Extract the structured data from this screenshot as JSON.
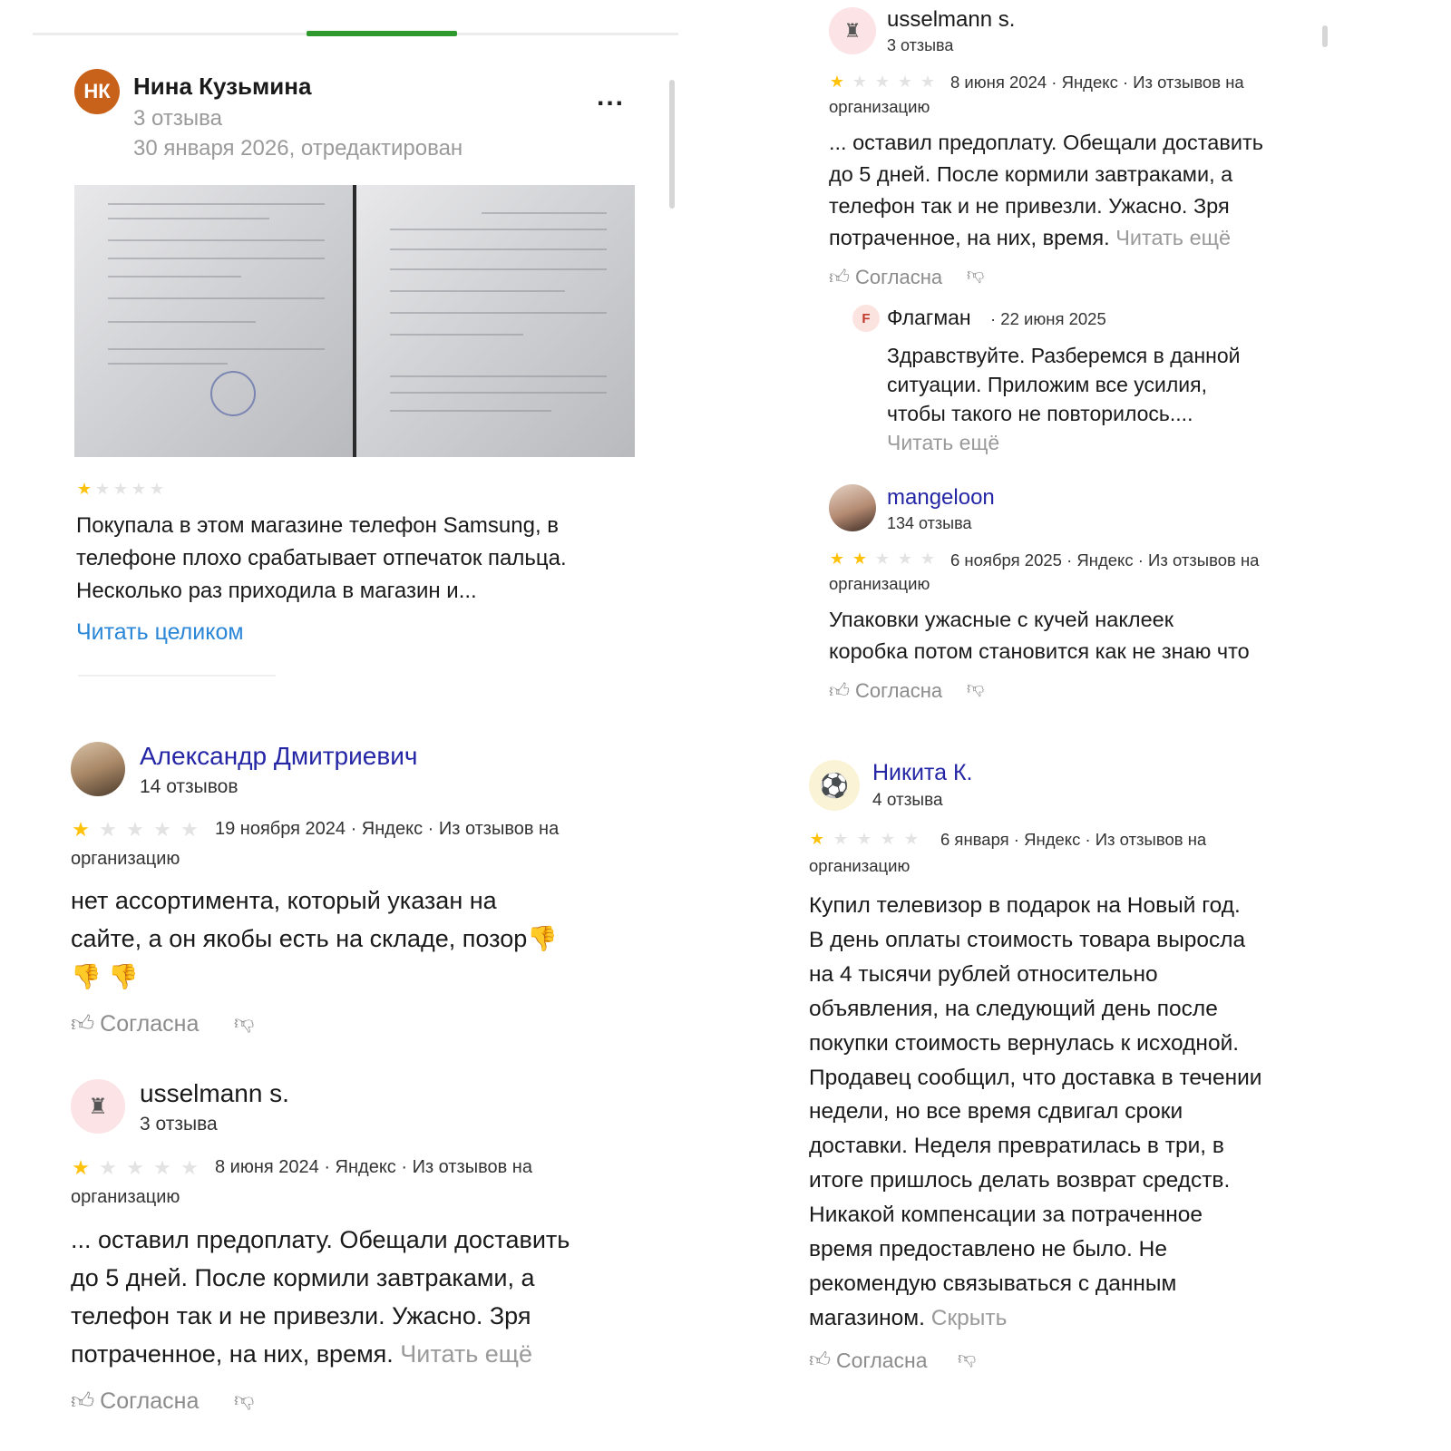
{
  "tabs": {
    "active_color": "#2e9a2e"
  },
  "colors": {
    "star_on": "#ffc20a",
    "star_off": "#e3e3e3",
    "link_blue": "#2a86d6",
    "name_link": "#2426a6",
    "avatar_nk": "#c8621a"
  },
  "review_nina": {
    "avatar_initials": "НК",
    "name": "Нина Кузьмина",
    "count": "3 отзыва",
    "date": "30 января 2026, отредактирован",
    "more_label": "...",
    "rating": 1,
    "text_line1": "Покупала в этом магазине телефон Samsung, в",
    "text_line2": "телефоне плохо срабатывает отпечаток пальца.",
    "text_line3": "Несколько раз приходила в магазин и...",
    "read_full": "Читать целиком"
  },
  "review_alexandr": {
    "name": "Александр Дмитриевич",
    "count": "14 отзывов",
    "rating": 1,
    "meta_line1": "19 ноября 2024 · Яндекс · Из отзывов на",
    "meta_line2": "организацию",
    "text_line1": "нет ассортимента, который указан на",
    "text_line2": "сайте, а он якобы есть на складе, позор",
    "emoji": "👎",
    "agree": "Согласна"
  },
  "review_usselmann_left": {
    "name": "usselmann s.",
    "count": "3 отзыва",
    "rating": 1,
    "meta_line1": "8 июня 2024 · Яндекс · Из отзывов на",
    "meta_line2": "организацию",
    "text_line1": "... оставил предоплату. Обещали доставить",
    "text_line2": "до 5 дней. После кормили завтраками, а",
    "text_line3": "телефон так и не привезли. Ужасно. Зря",
    "text_line4": "потраченное, на них, время.",
    "read_more": "Читать ещё",
    "agree": "Согласна"
  },
  "review_usselmann_right": {
    "name": "usselmann s.",
    "count": "3 отзыва",
    "rating": 1,
    "meta_line1": "8 июня 2024 · Яндекс · Из отзывов на",
    "meta_line2": "организацию",
    "text_line1": "... оставил предоплату. Обещали доставить",
    "text_line2": "до 5 дней. После кормили завтраками, а",
    "text_line3": "телефон так и не привезли. Ужасно. Зря",
    "text_line4": "потраченное, на них, время.",
    "read_more": "Читать ещё",
    "agree": "Согласна",
    "reply": {
      "avatar_letter": "F",
      "author": "Флагман",
      "date": "· 22 июня 2025",
      "text_line1": "Здравствуйте. Разберемся в данной",
      "text_line2": "ситуации. Приложим все усилия,",
      "text_line3": "чтобы такого не повторилось....",
      "read_more": "Читать ещё"
    }
  },
  "review_mangeloon": {
    "name": "mangeloon",
    "count": "134 отзыва",
    "rating": 2,
    "meta_line1": "6 ноября 2025 · Яндекс · Из отзывов на",
    "meta_line2": "организацию",
    "text_line1": "Упаковки ужасные с кучей наклеек",
    "text_line2": "коробка потом становится как не знаю что",
    "agree": "Согласна"
  },
  "review_nikita": {
    "name": "Никита К.",
    "count": "4 отзыва",
    "rating": 1,
    "meta_line1": "6 января · Яндекс · Из отзывов на",
    "meta_line2": "организацию",
    "lines": [
      "Купил телевизор в подарок на Новый год.",
      "В день оплаты стоимость товара выросла",
      "на 4 тысячи рублей относительно",
      "объявления, на следующий день после",
      "покупки стоимость вернулась к исходной.",
      "Продавец сообщил, что доставка в течении",
      "недели, но все время сдвигал сроки",
      "доставки. Неделя превратилась в три, в",
      "итоге пришлось делать возврат средств.",
      "Никакой компенсации за потраченное",
      "время предоставлено не было. Не",
      "рекомендую связываться с данным",
      "магазином."
    ],
    "hide": "Скрыть",
    "agree": "Согласна"
  }
}
